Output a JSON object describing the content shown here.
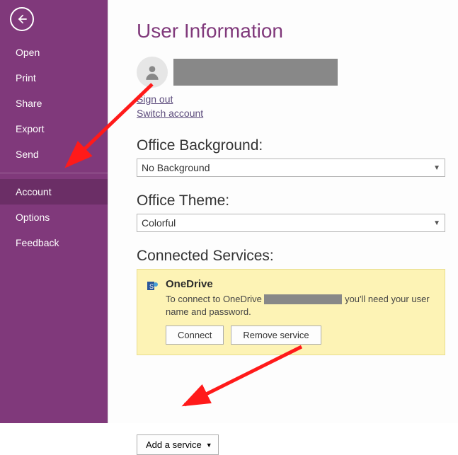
{
  "sidebar": {
    "items": [
      {
        "label": "Open"
      },
      {
        "label": "Print"
      },
      {
        "label": "Share"
      },
      {
        "label": "Export"
      },
      {
        "label": "Send"
      },
      {
        "label": "Account",
        "selected": true
      },
      {
        "label": "Options"
      },
      {
        "label": "Feedback"
      }
    ]
  },
  "content": {
    "heading": "User Information",
    "signout": "Sign out",
    "switch": "Switch account",
    "bg_heading": "Office Background:",
    "bg_value": "No Background",
    "theme_heading": "Office Theme:",
    "theme_value": "Colorful",
    "services_heading": "Connected Services:",
    "service": {
      "name": "OneDrive",
      "desc_pre": "To connect to OneDrive ",
      "desc_post": " you'll need your user name and password.",
      "connect": "Connect",
      "remove": "Remove service"
    },
    "add_service": "Add a service"
  }
}
